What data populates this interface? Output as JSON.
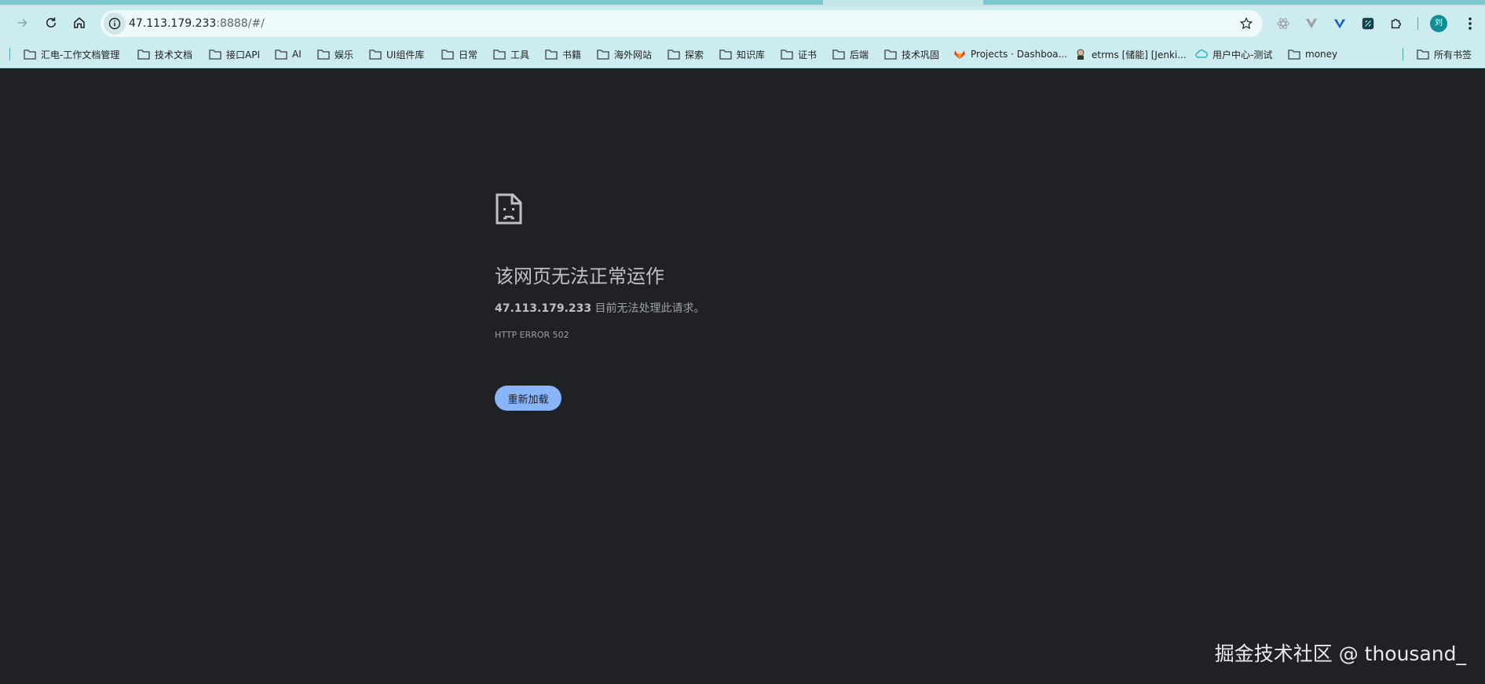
{
  "colors": {
    "toolbar_bg": "#cdecef",
    "page_bg": "#202124",
    "button_bg": "#8ab4f8",
    "profile_bg": "#0f8f95"
  },
  "address_bar": {
    "host": "47.113.179.233",
    "path": ":8888/#/"
  },
  "profile": {
    "initial": "刘"
  },
  "icons": {
    "back": "arrow-right-icon",
    "reload": "reload-icon",
    "home": "home-icon",
    "site_info": "info-icon",
    "bookmark": "star-icon",
    "menu": "three-dots-icon",
    "extensions_menu": "puzzle-icon"
  },
  "bookmarks": [
    {
      "label": "汇电-工作文档管理",
      "icon": "folder-icon"
    },
    {
      "label": "技术文档",
      "icon": "folder-icon"
    },
    {
      "label": "接口API",
      "icon": "folder-icon"
    },
    {
      "label": "AI",
      "icon": "folder-icon"
    },
    {
      "label": "娱乐",
      "icon": "folder-icon"
    },
    {
      "label": "UI组件库",
      "icon": "folder-icon"
    },
    {
      "label": "日常",
      "icon": "folder-icon"
    },
    {
      "label": "工具",
      "icon": "folder-icon"
    },
    {
      "label": "书籍",
      "icon": "folder-icon"
    },
    {
      "label": "海外网站",
      "icon": "folder-icon"
    },
    {
      "label": "探索",
      "icon": "folder-icon"
    },
    {
      "label": "知识库",
      "icon": "folder-icon"
    },
    {
      "label": "证书",
      "icon": "folder-icon"
    },
    {
      "label": "后端",
      "icon": "folder-icon"
    },
    {
      "label": "技术巩固",
      "icon": "folder-icon"
    },
    {
      "label": "Projects · Dashboa...",
      "icon": "gitlab-icon"
    },
    {
      "label": "etrms [储能] [Jenki...",
      "icon": "jenkins-icon"
    },
    {
      "label": "用户中心-测试",
      "icon": "cloud-icon"
    },
    {
      "label": "money",
      "icon": "folder-icon"
    }
  ],
  "all_bookmarks": {
    "label": "所有书签",
    "icon": "folder-icon"
  },
  "error": {
    "icon": "sad-page-icon",
    "title": "该网页无法正常运作",
    "host": "47.113.179.233",
    "message": " 目前无法处理此请求。",
    "code": "HTTP ERROR 502",
    "reload_label": "重新加载"
  },
  "watermark": "掘金技术社区 @ thousand_"
}
